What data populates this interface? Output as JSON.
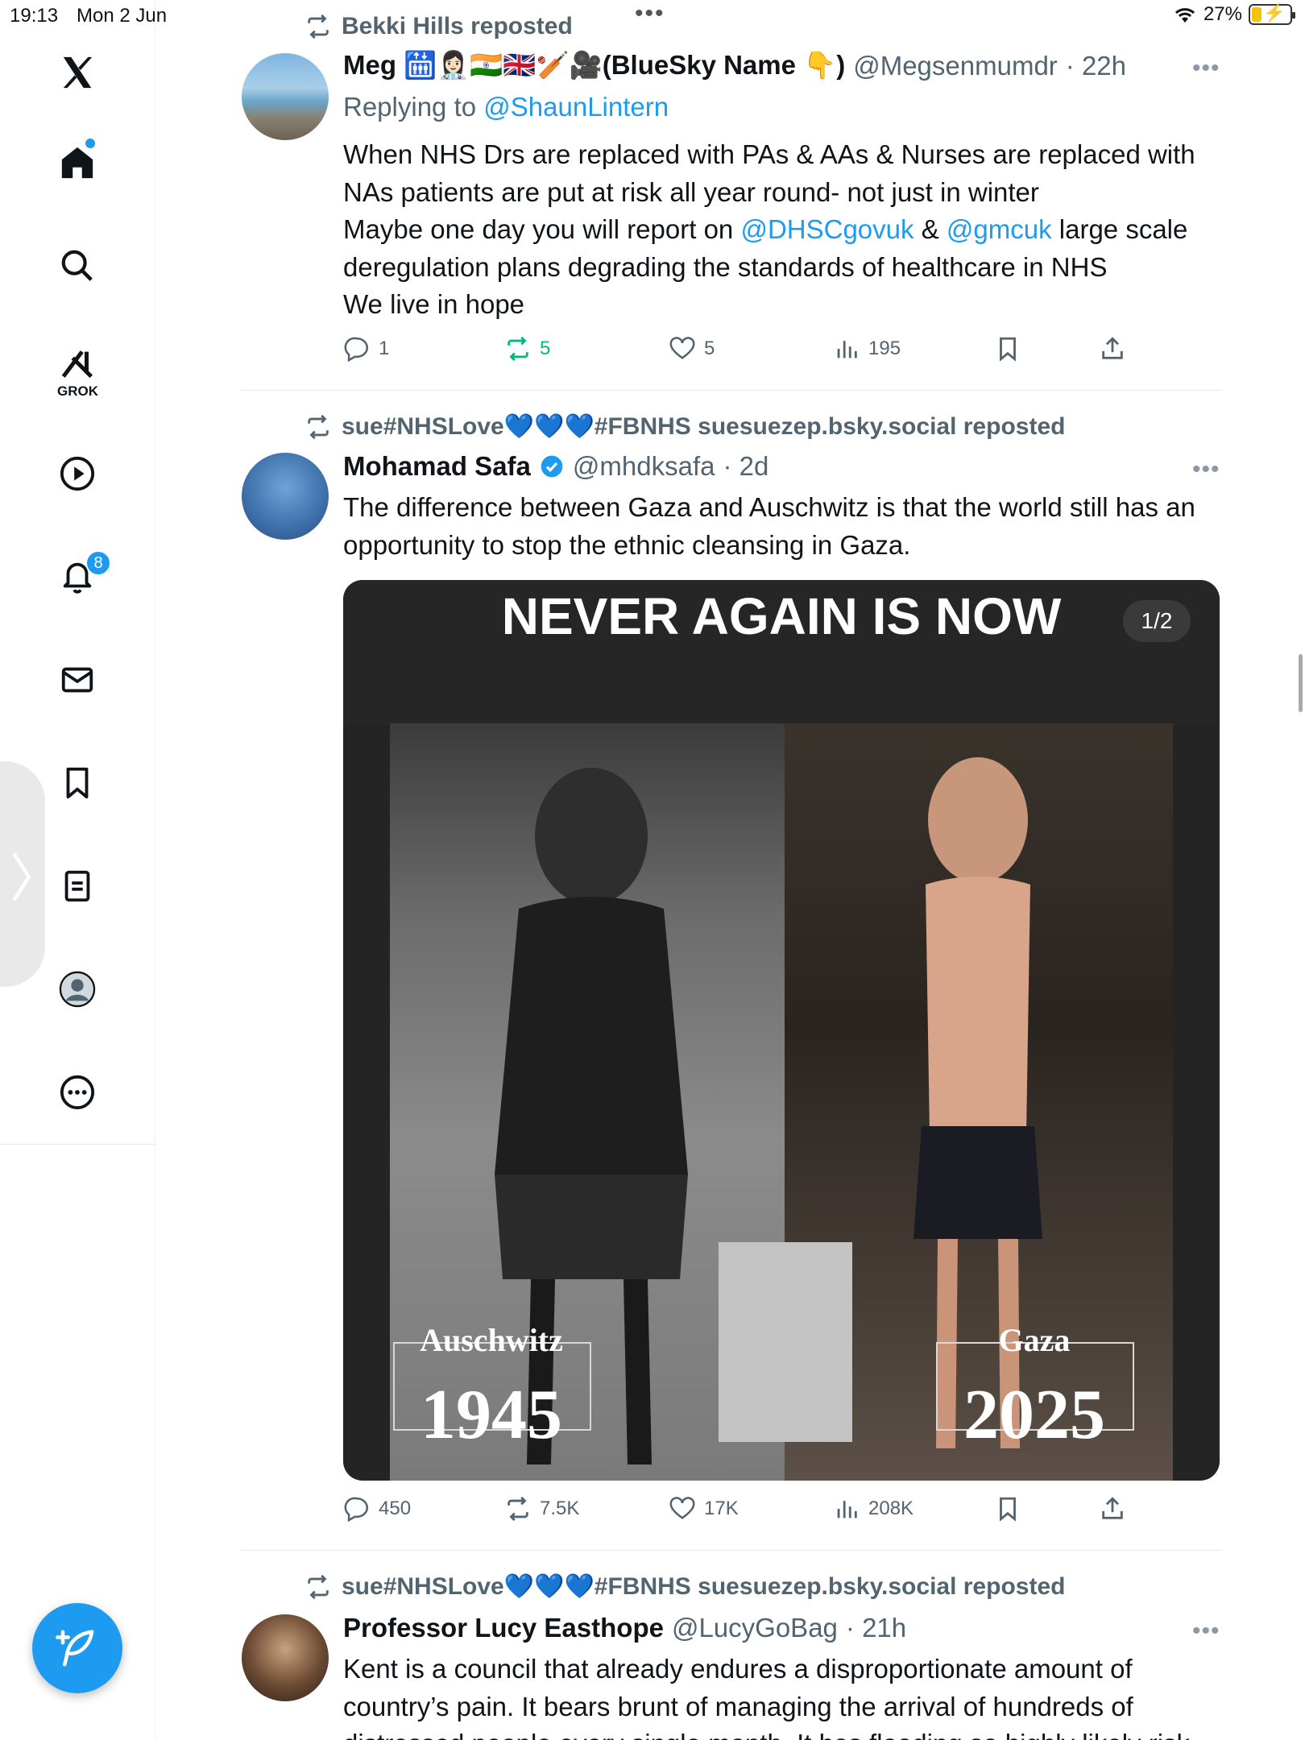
{
  "status_bar": {
    "time": "19:13",
    "date": "Mon 2 Jun",
    "battery": "27%",
    "battery_level": 0.27
  },
  "sidebar": {
    "grok_label": "GROK",
    "notification_count": "8"
  },
  "tweets": [
    {
      "reposted_by": "Bekki Hills reposted",
      "name": "Meg 🛗👩🏻‍⚕️🇮🇳🇬🇧🏏🎥(BlueSky Name 👇)",
      "handle": "@Megsenmumdr",
      "time": "· 22h",
      "replying_prefix": "Replying to",
      "replying_to": "@ShaunLintern",
      "text_line1": "When NHS Drs are replaced with PAs & AAs & Nurses are replaced with",
      "text_line2": "NAs patients are put at risk all year round- not just in winter",
      "text_line3_a": "Maybe one day you will report on",
      "text_line3_link1": "@DHSCgovuk",
      "text_line3_mid": "&",
      "text_line3_link2": "@gmcuk",
      "text_line3_b": "large scale",
      "text_line4": "deregulation plans degrading the standards of healthcare in NHS",
      "text_line5": "We live in hope",
      "replies": "1",
      "reposts": "5",
      "likes": "5",
      "views": "195"
    },
    {
      "reposted_by": "sue#NHSLove💙💙💙#FBNHS suesuezep.bsky.social reposted",
      "name": "Mohamad Safa",
      "handle": "@mhdksafa",
      "time": "· 2d",
      "text": "The difference between Gaza and Auschwitz is that the world still has an opportunity to stop the ethnic cleansing in Gaza.",
      "media_title": "NEVER AGAIN IS NOW",
      "media_count": "1/2",
      "caption_left_place": "Auschwitz",
      "caption_left_year": "1945",
      "caption_right_place": "Gaza",
      "caption_right_year": "2025",
      "replies": "450",
      "reposts": "7.5K",
      "likes": "17K",
      "views": "208K"
    },
    {
      "reposted_by": "sue#NHSLove💙💙💙#FBNHS suesuezep.bsky.social reposted",
      "name": "Professor Lucy Easthope",
      "handle": "@LucyGoBag",
      "time": "· 21h",
      "text_line1": "Kent is a council that already endures a disproportionate amount of",
      "text_line2": "country’s pain. It bears brunt of managing the arrival of hundreds of",
      "text_line3": "distressed people every single month. It has flooding so highly likely risk"
    }
  ],
  "colors": {
    "accent": "#1d9bf0",
    "repost_green": "#00ba7c",
    "muted": "#536471"
  }
}
